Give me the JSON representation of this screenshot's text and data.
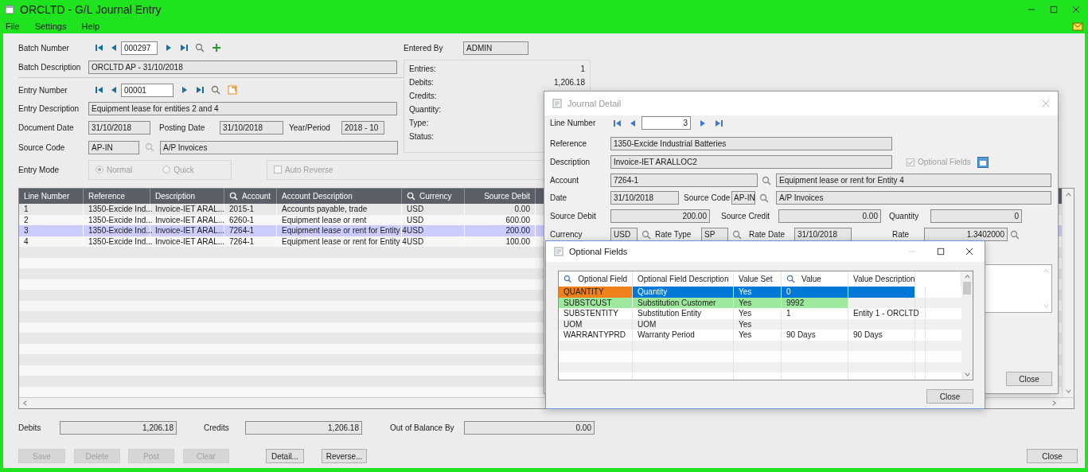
{
  "window": {
    "title": "ORCLTD - G/L Journal Entry"
  },
  "menu": [
    "File",
    "Settings",
    "Help"
  ],
  "batch": {
    "number_label": "Batch Number",
    "number": "000297",
    "description_label": "Batch Description",
    "description": "ORCLTD AP - 31/10/2018"
  },
  "entered_by": {
    "label": "Entered By",
    "value": "ADMIN"
  },
  "summary": [
    {
      "label": "Entries:",
      "value": "1"
    },
    {
      "label": "Debits:",
      "value": "1,206.18"
    },
    {
      "label": "Credits:"
    },
    {
      "label": "Quantity:"
    },
    {
      "label": "Type:"
    },
    {
      "label": "Status:"
    }
  ],
  "entry": {
    "number_label": "Entry Number",
    "number": "00001",
    "description_label": "Entry Description",
    "description": "Equipment lease for entities 2 and 4",
    "document_date_label": "Document Date",
    "document_date": "31/10/2018",
    "posting_date_label": "Posting Date",
    "posting_date": "31/10/2018",
    "year_period_label": "Year/Period",
    "year_period": "2018 - 10",
    "source_code_label": "Source Code",
    "source_code": "AP-IN",
    "source_code_description": "A/P Invoices",
    "mode_label": "Entry Mode",
    "modes": [
      {
        "label": "Normal",
        "selected": true
      },
      {
        "label": "Quick",
        "selected": false
      }
    ],
    "auto_reverse": {
      "label": "Auto Reverse",
      "checked": false
    }
  },
  "table": {
    "columns": [
      {
        "label": "Line Number",
        "kind": "text"
      },
      {
        "label": "Reference",
        "kind": "text"
      },
      {
        "label": "Description",
        "kind": "text"
      },
      {
        "label": "Account",
        "kind": "lookup"
      },
      {
        "label": "Account Description",
        "kind": "text"
      },
      {
        "label": "Currency",
        "kind": "lookup"
      },
      {
        "label": "Source Debit",
        "kind": "amount"
      }
    ],
    "rows": [
      {
        "cells": [
          "1",
          "1350-Excide Ind...",
          "Invoice-IET ARAL...",
          "2015-1",
          "Accounts payable, trade",
          "USD",
          "0.00"
        ],
        "selected": false
      },
      {
        "cells": [
          "2",
          "1350-Excide Ind...",
          "Invoice-IET ARAL...",
          "6260-1",
          "Equipment lease or rent",
          "USD",
          "600.00"
        ],
        "selected": false
      },
      {
        "cells": [
          "3",
          "1350-Excide Ind...",
          "Invoice-IET ARAL...",
          "7264-1",
          "Equipment lease or rent for Entity 4",
          "USD",
          "200.00"
        ],
        "selected": true
      },
      {
        "cells": [
          "4",
          "1350-Excide Ind...",
          "Invoice-IET ARAL...",
          "7264-1",
          "Equipment lease or rent for Entity 4",
          "USD",
          "100.00"
        ],
        "selected": false
      }
    ]
  },
  "totals": [
    {
      "label": "Debits",
      "value": "1,206.18"
    },
    {
      "label": "Credits",
      "value": "1,206.18"
    },
    {
      "label": "Out of Balance By",
      "value": "0.00"
    }
  ],
  "buttons": [
    {
      "label": "Save",
      "disabled": true
    },
    {
      "label": "Delete",
      "disabled": true
    },
    {
      "label": "Post",
      "disabled": true
    },
    {
      "label": "Clear",
      "disabled": true
    },
    {
      "label": "Detail...",
      "disabled": false
    },
    {
      "label": "Reverse...",
      "disabled": false
    }
  ],
  "close_button": "Close",
  "journal_detail": {
    "title": "Journal Detail",
    "line_number_label": "Line Number",
    "line_number": "3",
    "reference_label": "Reference",
    "reference": "1350-Excide Industrial Batteries",
    "description_label": "Description",
    "description": "Invoice-IET ARALLOC2",
    "optional_fields": {
      "label": "Optional Fields",
      "checked": true
    },
    "account_label": "Account",
    "account": "7264-1",
    "account_description": "Equipment lease or rent for Entity 4",
    "date_label": "Date",
    "date": "31/10/2018",
    "source_code_label": "Source Code",
    "source_code": "AP-IN",
    "source_code_description": "A/P Invoices",
    "source_debit_label": "Source Debit",
    "source_debit": "200.00",
    "source_credit_label": "Source Credit",
    "source_credit": "0.00",
    "quantity_label": "Quantity",
    "quantity": "0",
    "currency_label": "Currency",
    "currency": "USD",
    "rate_type_label": "Rate Type",
    "rate_type": "SP",
    "rate_date_label": "Rate Date",
    "rate_date": "31/10/2018",
    "rate_label": "Rate",
    "rate": "1.3402000",
    "close_button": "Close"
  },
  "optional_fields": {
    "title": "Optional Fields",
    "columns": [
      {
        "label": "Optional Field",
        "kind": "lookup"
      },
      {
        "label": "Optional Field Description",
        "kind": "text"
      },
      {
        "label": "Value Set",
        "kind": "text"
      },
      {
        "label": "Value",
        "kind": "lookup"
      },
      {
        "label": "Value Description",
        "kind": "text"
      }
    ],
    "rows": [
      {
        "cells": [
          "QUANTITY",
          "Quantity",
          "Yes",
          "0",
          ""
        ],
        "selected": true,
        "highlighted": false
      },
      {
        "cells": [
          "SUBSTCUST",
          "Substitution Customer",
          "Yes",
          "9992",
          ""
        ],
        "selected": false,
        "highlighted": true
      },
      {
        "cells": [
          "SUBSTENTITY",
          "Substitution Entity",
          "Yes",
          "1",
          "Entity 1 - ORCLTD"
        ],
        "selected": false,
        "highlighted": false
      },
      {
        "cells": [
          "UOM",
          "UOM",
          "Yes",
          "",
          ""
        ],
        "selected": false,
        "highlighted": false
      },
      {
        "cells": [
          "WARRANTYPRD",
          "Warranty Period",
          "Yes",
          "90 Days",
          "90 Days"
        ],
        "selected": false,
        "highlighted": false
      }
    ],
    "close_button": "Close"
  }
}
